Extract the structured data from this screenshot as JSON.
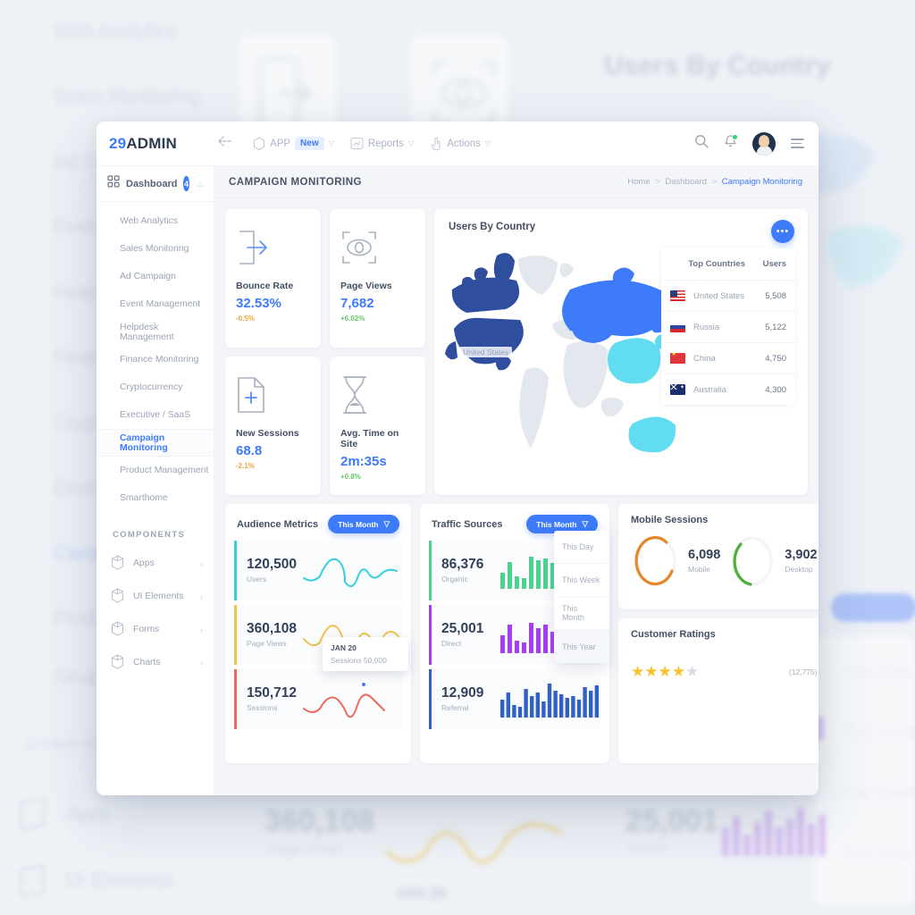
{
  "brand": {
    "prefix": "29",
    "name": "ADMIN"
  },
  "topnav": {
    "collapse_icon": "collapse-arrow-icon",
    "items": [
      {
        "label": "APP",
        "icon": "hexagon-icon",
        "badge": "New",
        "caret": "▽"
      },
      {
        "label": "Reports",
        "icon": "report-chart-icon",
        "caret": "▽"
      },
      {
        "label": "Actions",
        "icon": "hand-pointer-icon",
        "caret": "▽"
      }
    ],
    "right_icons": [
      "search-icon",
      "bell-icon",
      "avatar",
      "hamburger-icon"
    ]
  },
  "sidebar": {
    "dashboard": {
      "label": "Dashboard",
      "badge": "4",
      "caret": "△"
    },
    "items": [
      {
        "label": "Web Analytics",
        "active": false
      },
      {
        "label": "Sales Monitoring",
        "active": false
      },
      {
        "label": "Ad Campaign",
        "active": false
      },
      {
        "label": "Event Management",
        "active": false
      },
      {
        "label": "Helpdesk Management",
        "active": false
      },
      {
        "label": "Finance Monitoring",
        "active": false
      },
      {
        "label": "Cryptocurrency",
        "active": false
      },
      {
        "label": "Executive / SaaS",
        "active": false
      },
      {
        "label": "Campaign Monitoring",
        "active": true
      },
      {
        "label": "Product Management",
        "active": false
      },
      {
        "label": "Smarthome",
        "active": false
      }
    ],
    "components_title": "COMPONENTS",
    "components": [
      {
        "label": "Apps",
        "icon": "cube-icon",
        "chevron": "›"
      },
      {
        "label": "UI Elements",
        "icon": "cube-icon",
        "chevron": "›"
      },
      {
        "label": "Forms",
        "icon": "cube-icon",
        "chevron": "›"
      },
      {
        "label": "Charts",
        "icon": "cube-icon",
        "chevron": "›"
      }
    ]
  },
  "page": {
    "title": "CAMPAIGN MONITORING",
    "breadcrumb": {
      "home": "Home",
      "section": "Dashboard",
      "current": "Campaign Monitoring",
      "sep": ">"
    }
  },
  "kpis": [
    {
      "title": "Bounce Rate",
      "value": "32.53%",
      "delta": "-0.5%",
      "dir": "down",
      "icon": "exit-arrow-icon"
    },
    {
      "title": "Page Views",
      "value": "7,682",
      "delta": "+6.02%",
      "dir": "up",
      "icon": "eye-scan-icon"
    },
    {
      "title": "New Sessions",
      "value": "68.8",
      "delta": "-2.1%",
      "dir": "down",
      "icon": "file-plus-icon"
    },
    {
      "title": "Avg. Time on Site",
      "value": "2m:35s",
      "delta": "+0.8%",
      "dir": "up",
      "icon": "hourglass-icon"
    }
  ],
  "map": {
    "title": "Users By Country",
    "more_label": "•••",
    "us_label": "United States",
    "table": {
      "columns": [
        "Top Countries",
        "Users"
      ],
      "rows": [
        {
          "country": "United States",
          "users": "5,508",
          "flag": "us"
        },
        {
          "country": "Russia",
          "users": "5,122",
          "flag": "ru"
        },
        {
          "country": "China",
          "users": "4,750",
          "flag": "cn"
        },
        {
          "country": "Australia",
          "users": "4,300",
          "flag": "au"
        }
      ]
    }
  },
  "audience": {
    "title": "Audience Metrics",
    "filter": "This Month",
    "caret": "▽",
    "rows": [
      {
        "value": "120,500",
        "label": "Users",
        "color": "#35cfe0"
      },
      {
        "value": "360,108",
        "label": "Page Views",
        "color": "#f2c14e"
      },
      {
        "value": "150,712",
        "label": "Sessions",
        "color": "#ef6a5a"
      }
    ],
    "tooltip": {
      "date": "JAN 20",
      "text": "Sessions 50,000"
    }
  },
  "traffic": {
    "title": "Traffic Sources",
    "filter": "This Month",
    "caret": "▽",
    "dropdown": [
      "This Day",
      "This Week",
      "This Month",
      "This Year"
    ],
    "dropdown_selected": "This Year",
    "rows": [
      {
        "value": "86,376",
        "label": "Organic",
        "color": "#4bd38d"
      },
      {
        "value": "25,001",
        "label": "Direct",
        "color": "#a63df5"
      },
      {
        "value": "12,909",
        "label": "Referral",
        "color": "#2f62c4"
      }
    ]
  },
  "mobile": {
    "title": "Mobile Sessions",
    "segments": [
      {
        "value": "6,098",
        "label": "Mobile",
        "color": "#e8862a",
        "percent": 72
      },
      {
        "value": "3,902",
        "label": "Desktop",
        "color": "#4caf36",
        "percent": 40
      }
    ]
  },
  "ratings": {
    "title": "Customer Ratings",
    "stars_filled": 4,
    "stars_total": 5,
    "count": "(12,775)"
  },
  "chart_data": [
    {
      "type": "line",
      "title": "Audience Metrics",
      "series": [
        {
          "name": "Users",
          "color": "#35cfe0",
          "values": [
            28,
            34,
            22,
            16,
            40,
            62,
            30,
            12,
            44,
            24,
            34,
            30
          ]
        },
        {
          "name": "Page Views",
          "color": "#f2c14e",
          "values": [
            30,
            22,
            14,
            30,
            50,
            42,
            20,
            46,
            36,
            52,
            58,
            48
          ]
        },
        {
          "name": "Sessions",
          "color": "#ef6a5a",
          "values": [
            24,
            30,
            20,
            36,
            44,
            28,
            14,
            34,
            26,
            52,
            58,
            40
          ]
        }
      ],
      "annotation": {
        "x": "JAN 20",
        "label": "Sessions 50,000"
      }
    },
    {
      "type": "bar",
      "title": "Traffic Sources",
      "series": [
        {
          "name": "Organic",
          "color": "#4bd38d",
          "values": [
            16,
            30,
            12,
            11,
            40,
            34,
            38,
            33,
            18,
            46,
            36,
            40
          ]
        },
        {
          "name": "Direct",
          "color": "#a63df5",
          "values": [
            20,
            32,
            13,
            12,
            38,
            30,
            36,
            26,
            16,
            42,
            34,
            44
          ]
        },
        {
          "name": "Referral",
          "color": "#2f62c4",
          "values": [
            22,
            30,
            16,
            12,
            36,
            26,
            32,
            22,
            42,
            34,
            30,
            26,
            28,
            24,
            40,
            36,
            44
          ]
        }
      ]
    },
    {
      "type": "pie",
      "title": "Mobile Sessions",
      "categories": [
        "Mobile",
        "Desktop"
      ],
      "values": [
        6098,
        3902
      ]
    }
  ]
}
